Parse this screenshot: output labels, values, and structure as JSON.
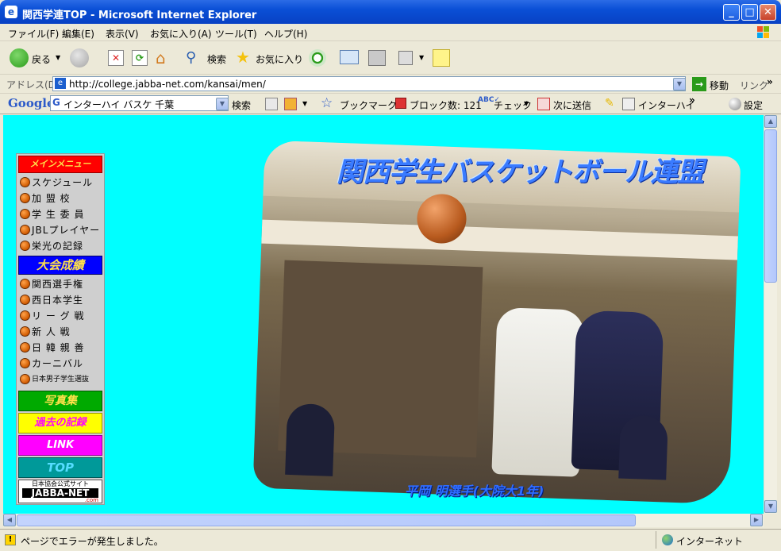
{
  "window": {
    "title": "関西学連TOP - Microsoft Internet Explorer",
    "app_icon": "ie-icon"
  },
  "menubar": {
    "items": [
      "ファイル(F)",
      "編集(E)",
      "表示(V)",
      "お気に入り(A)",
      "ツール(T)",
      "ヘルプ(H)"
    ]
  },
  "toolbar": {
    "back": "戻る",
    "search": "検索",
    "favorites": "お気に入り"
  },
  "addressbar": {
    "label": "アドレス(D)",
    "url": "http://college.jabba-net.com/kansai/men/",
    "go": "移動",
    "links": "リンク"
  },
  "googlebar": {
    "logo": "Google",
    "query": "インターハイ バスケ 千葉",
    "search": "検索",
    "bookmarks": "ブックマーク",
    "blocked": "ブロック数: 121",
    "check": "チェック",
    "send": "次に送信",
    "interhigh": "インターハイ",
    "settings": "設定"
  },
  "nav": {
    "main_menu": "メインメニュー",
    "items1": [
      "スケジュール",
      "加 盟 校",
      "学 生 委 員",
      "JBLプレイヤー",
      "栄光の記録"
    ],
    "tournament": "大会成績",
    "items2": [
      "関西選手権",
      "西日本学生",
      "リ ー グ 戦",
      "新 人 戦",
      "日 韓 親 善",
      "カーニバル",
      "日本男子学生選抜"
    ],
    "photo": "写真集",
    "history": "過去の記録",
    "link": "LINK",
    "top": "TOP",
    "jabba_small": "日本協会公式サイト",
    "jabba": "JABBA-NET",
    "jabba_com": ".com"
  },
  "main": {
    "site_title": "関西学生バスケットボール連盟",
    "caption": "平岡 明選手(大院大1年)"
  },
  "statusbar": {
    "message": "ページでエラーが発生しました。",
    "zone": "インターネット"
  },
  "colors": {
    "page_bg": "#00FFFF",
    "titlebar": "#0A4FD6",
    "banner_red": "#FF0000",
    "banner_blue": "#0000FF",
    "banner_green": "#00AA00",
    "banner_yellow": "#FFFF00",
    "banner_magenta": "#FF00FF",
    "banner_teal": "#009999"
  }
}
